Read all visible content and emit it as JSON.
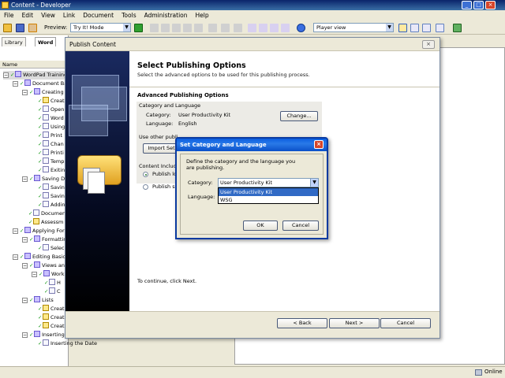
{
  "app": {
    "title": "Content - Developer"
  },
  "menu": [
    "File",
    "Edit",
    "View",
    "Link",
    "Document",
    "Tools",
    "Administration",
    "Help"
  ],
  "toolbar": {
    "preview_label": "Preview:",
    "preview_value": "Try It! Mode",
    "view_value": "Player view"
  },
  "left_pane": {
    "tabs": [
      "Library",
      "Word"
    ],
    "column_header": "Name",
    "tree": [
      "WordPad Training",
      "Document Ba",
      "Creating",
      "Creat",
      "Open",
      "Word",
      "Using",
      "Print",
      "Chan",
      "Printi",
      "Temp",
      "Exitin",
      "Saving Do",
      "Savin",
      "Savin",
      "Addin",
      "Documen",
      "Assessm",
      "Applying For",
      "Formattin",
      "Selec",
      "Editing Basic",
      "Views an",
      "Work",
      "H",
      "C",
      "Lists",
      "Creat",
      "Creat",
      "Creat",
      "Inserting Dates and Objects",
      "Inserting the Date"
    ]
  },
  "status": {
    "connection": "Online"
  },
  "publish_dialog": {
    "title": "Publish Content",
    "heading": "Select Publishing Options",
    "subheading": "Select the advanced options to be used for this publishing process.",
    "section_title": "Advanced Publishing Options",
    "group_label": "Category and Language",
    "category_label": "Category:",
    "category_value": "User Productivity Kit",
    "language_label": "Language:",
    "language_value": "English",
    "change_button": "Change...",
    "other_publishing_label": "Use other publi",
    "import_button": "Import Set",
    "content_include_label": "Content Includ",
    "radio_1": "Publish loc",
    "radio_2": "Publish se",
    "continue_text": "To continue, click Next.",
    "back_button": "< Back",
    "next_button": "Next >",
    "cancel_button": "Cancel"
  },
  "category_dialog": {
    "title": "Set Category and Language",
    "instruction": "Define the category and the language you are publishing.",
    "category_label": "Category:",
    "category_value": "User Productivity Kit",
    "options": [
      "User Productivity Kit",
      "WSG"
    ],
    "language_label": "Language:",
    "ok_button": "OK",
    "cancel_button": "Cancel"
  }
}
